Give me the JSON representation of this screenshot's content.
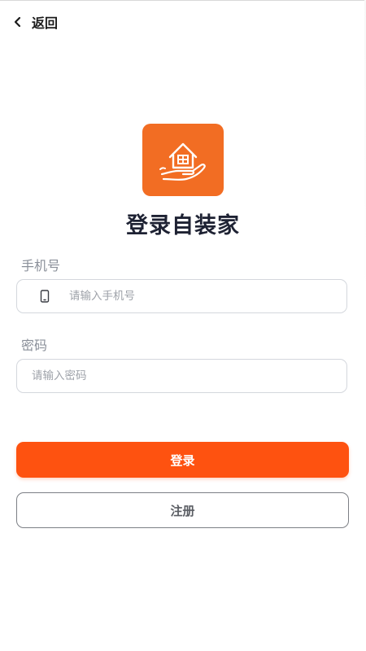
{
  "header": {
    "back_label": "返回",
    "back_icon": "chevron-left-icon"
  },
  "app": {
    "logo_icon": "house-in-hand-icon",
    "title": "登录自装家",
    "brand_color": "#f26d23"
  },
  "form": {
    "phone": {
      "label": "手机号",
      "placeholder": "请输入手机号",
      "value": "",
      "icon": "phone-icon"
    },
    "password": {
      "label": "密码",
      "placeholder": "请输入密码",
      "value": ""
    }
  },
  "actions": {
    "login_label": "登录",
    "login_color": "#fe5210",
    "register_label": "注册"
  }
}
